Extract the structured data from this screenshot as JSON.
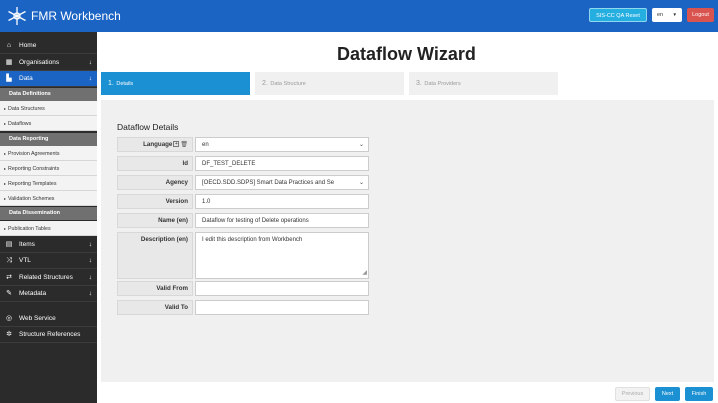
{
  "app": {
    "title": "FMR Workbench",
    "logo_icon": "snowflake-icon",
    "env_button": "SIS-CC QA Reset",
    "language": "en",
    "logout": "Logout",
    "colors": {
      "brand": "#1b64c4",
      "accent": "#1b90d2",
      "danger": "#d9534f",
      "env": "#25aee0"
    }
  },
  "sidebar": {
    "home": "Home",
    "organisations": "Organisations",
    "data": "Data",
    "data_definitions": "Data Definitions",
    "data_structures": "Data Structures",
    "dataflows": "Dataflows",
    "data_reporting": "Data Reporting",
    "provision_agreements": "Provision Agreements",
    "reporting_constraints": "Reporting Constraints",
    "reporting_templates": "Reporting Templates",
    "validation_schemes": "Validation Schemes",
    "data_dissemination": "Data Dissemination",
    "publication_tables": "Publication Tables",
    "items": "Items",
    "vtl": "VTL",
    "related_structures": "Related Structures",
    "metadata": "Metadata",
    "web_service": "Web Service",
    "structure_references": "Structure References",
    "expand_arrow": "↓",
    "sub_marker": "▸"
  },
  "wizard": {
    "title": "Dataflow Wizard",
    "steps": [
      {
        "num": "1.",
        "label": "Details"
      },
      {
        "num": "2.",
        "label": "Data Structure"
      },
      {
        "num": "3.",
        "label": "Data Providers"
      }
    ],
    "section_title": "Dataflow Details",
    "fields": {
      "language": {
        "label": "Language",
        "value": "en"
      },
      "id": {
        "label": "Id",
        "value": "DF_TEST_DELETE"
      },
      "agency": {
        "label": "Agency",
        "value": "[OECD.SDD.SDPS] Smart Data Practices and Se"
      },
      "version": {
        "label": "Version",
        "value": "1.0"
      },
      "name": {
        "label": "Name (en)",
        "value": "Dataflow for testing of Delete operations"
      },
      "description": {
        "label": "Description (en)",
        "value": "I edit this description from Workbench"
      },
      "valid_from": {
        "label": "Valid From",
        "value": ""
      },
      "valid_to": {
        "label": "Valid To",
        "value": ""
      }
    },
    "buttons": {
      "previous": "Previous",
      "next": "Next",
      "finish": "Finish"
    }
  }
}
